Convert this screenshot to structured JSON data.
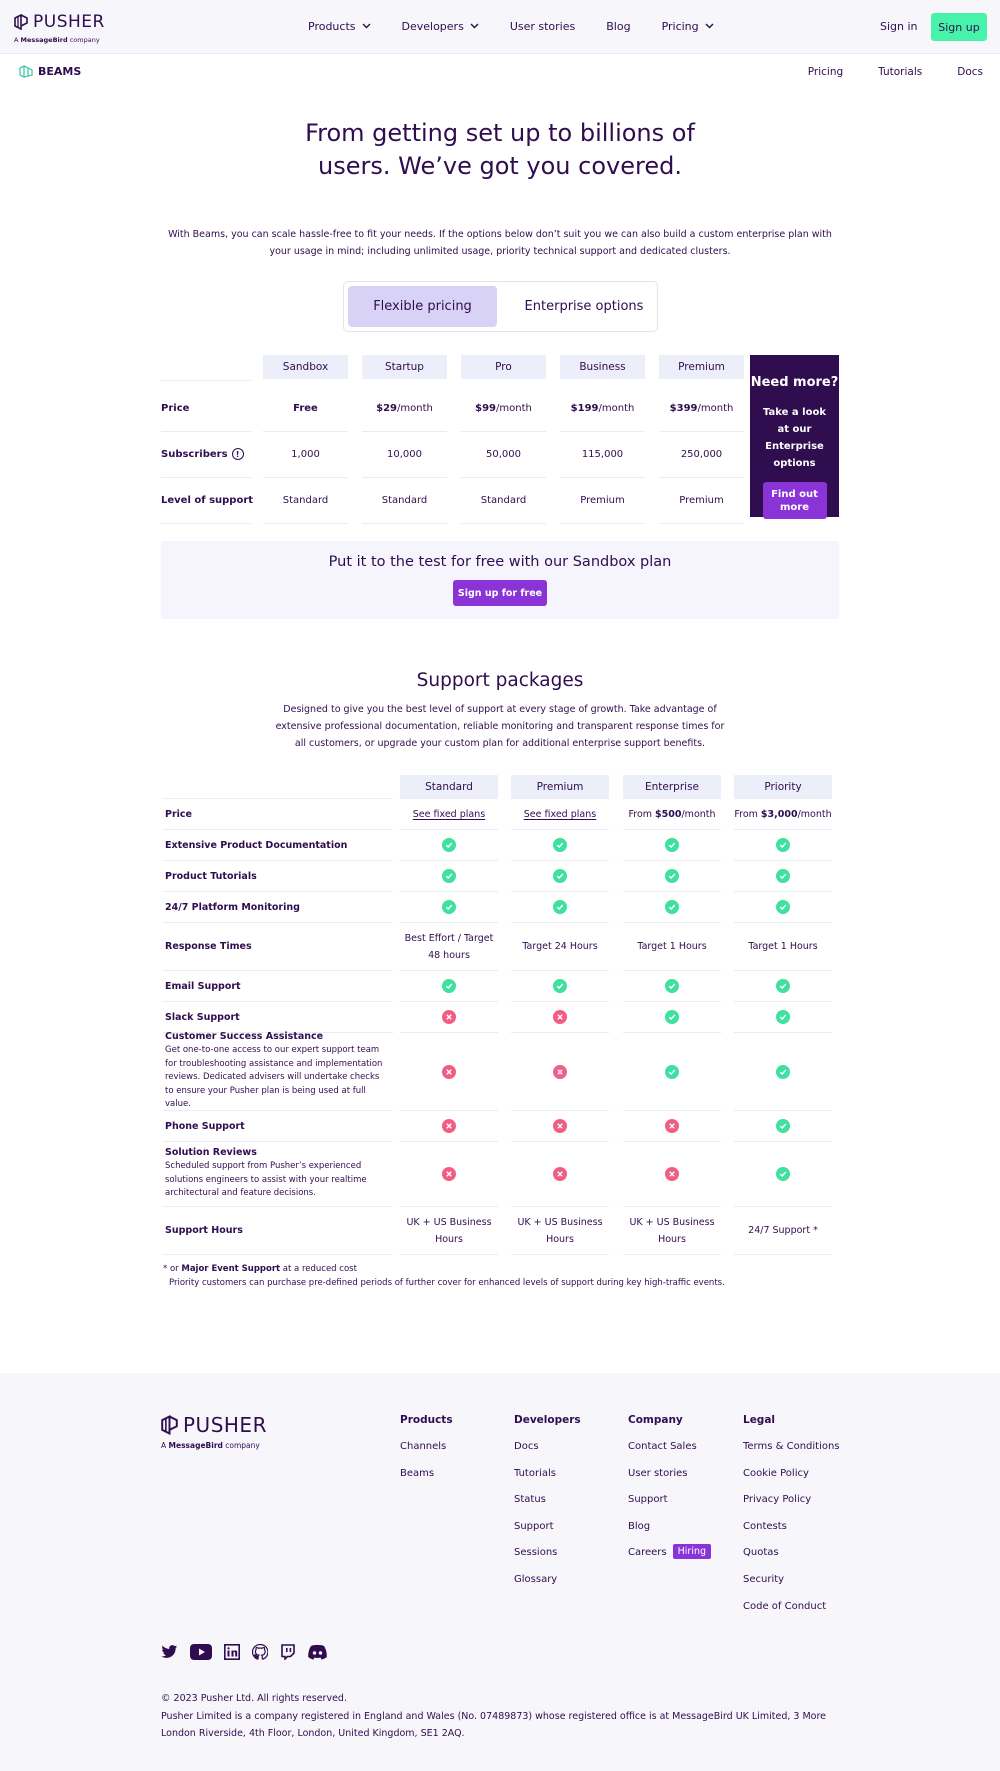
{
  "brand": {
    "name": "PUSHER",
    "tagline_prefix": "A",
    "tagline_brand": "MessageBird",
    "tagline_suffix": "company"
  },
  "nav": {
    "items": [
      {
        "label": "Products",
        "has_dropdown": true
      },
      {
        "label": "Developers",
        "has_dropdown": true
      },
      {
        "label": "User stories",
        "has_dropdown": false
      },
      {
        "label": "Blog",
        "has_dropdown": false
      },
      {
        "label": "Pricing",
        "has_dropdown": true
      }
    ],
    "sign_in": "Sign in",
    "sign_up": "Sign up"
  },
  "subnav": {
    "product": "BEAMS",
    "links": [
      "Pricing",
      "Tutorials",
      "Docs"
    ]
  },
  "hero": {
    "title": "From getting set up to billions of users. We’ve got you covered.",
    "text": "With Beams, you can scale hassle-free to fit your needs. If the options below don’t suit you we can also build a custom enterprise plan with your usage in mind; including unlimited usage, priority technical support and dedicated clusters.",
    "toggle": {
      "active": "Flexible pricing",
      "inactive": "Enterprise options"
    }
  },
  "pricing": {
    "plans": [
      "Sandbox",
      "Startup",
      "Pro",
      "Business",
      "Premium"
    ],
    "rows": [
      {
        "label": "Price",
        "cells": [
          {
            "bold": "Free",
            "rest": ""
          },
          {
            "bold": "$29",
            "rest": "/month"
          },
          {
            "bold": "$99",
            "rest": "/month"
          },
          {
            "bold": "$199",
            "rest": "/month"
          },
          {
            "bold": "$399",
            "rest": "/month"
          }
        ]
      },
      {
        "label": "Subscribers",
        "info_icon": "info-icon",
        "cells": [
          {
            "bold": "",
            "rest": "1,000"
          },
          {
            "bold": "",
            "rest": "10,000"
          },
          {
            "bold": "",
            "rest": "50,000"
          },
          {
            "bold": "",
            "rest": "115,000"
          },
          {
            "bold": "",
            "rest": "250,000"
          }
        ]
      },
      {
        "label": "Level of support",
        "cells": [
          {
            "bold": "",
            "rest": "Standard"
          },
          {
            "bold": "",
            "rest": "Standard"
          },
          {
            "bold": "",
            "rest": "Standard"
          },
          {
            "bold": "",
            "rest": "Premium"
          },
          {
            "bold": "",
            "rest": "Premium"
          }
        ]
      }
    ],
    "need_more": {
      "title": "Need more?",
      "text": "Take a look at our Enterprise options",
      "button": "Find out more"
    }
  },
  "sandbox_band": {
    "title": "Put it to the test for free with our Sandbox plan",
    "button": "Sign up for free"
  },
  "support": {
    "title": "Support packages",
    "text": "Designed to give you the best level of support at every stage of growth. Take advantage of extensive professional documentation, reliable monitoring and transparent response times for all customers, or upgrade your custom plan for additional enterprise support benefits.",
    "columns": [
      "Standard",
      "Premium",
      "Enterprise",
      "Priority"
    ],
    "price_row": {
      "label": "Price",
      "cells": [
        {
          "type": "link",
          "text": "See fixed plans"
        },
        {
          "type": "link",
          "text": "See fixed plans"
        },
        {
          "type": "price",
          "prefix": "From ",
          "bold": "$500",
          "suffix": "/month"
        },
        {
          "type": "price",
          "prefix": "From ",
          "bold": "$3,000",
          "suffix": "/month"
        }
      ]
    },
    "rows": [
      {
        "label": "Extensive Product Documentation",
        "desc": "",
        "values": [
          "yes",
          "yes",
          "yes",
          "yes"
        ]
      },
      {
        "label": "Product Tutorials",
        "desc": "",
        "values": [
          "yes",
          "yes",
          "yes",
          "yes"
        ]
      },
      {
        "label": "24/7 Platform Monitoring",
        "desc": "",
        "values": [
          "yes",
          "yes",
          "yes",
          "yes"
        ]
      },
      {
        "label": "Response Times",
        "desc": "",
        "values": [
          "Best Effort / Target 48 hours",
          "Target 24 Hours",
          "Target 1 Hours",
          "Target 1 Hours"
        ]
      },
      {
        "label": "Email Support",
        "desc": "",
        "values": [
          "yes",
          "yes",
          "yes",
          "yes"
        ]
      },
      {
        "label": "Slack Support",
        "desc": "",
        "values": [
          "no",
          "no",
          "yes",
          "yes"
        ]
      },
      {
        "label": "Customer Success Assistance",
        "desc": "Get one-to-one access to our expert support team for troubleshooting assistance and implementation reviews. Dedicated advisers will undertake checks to ensure your Pusher plan is being used at full value.",
        "values": [
          "no",
          "no",
          "yes",
          "yes"
        ]
      },
      {
        "label": "Phone Support",
        "desc": "",
        "values": [
          "no",
          "no",
          "no",
          "yes"
        ]
      },
      {
        "label": "Solution Reviews",
        "desc": "Scheduled support from Pusher’s experienced solutions engineers to assist with your realtime architectural and feature decisions.",
        "values": [
          "no",
          "no",
          "no",
          "yes"
        ]
      },
      {
        "label": "Support Hours",
        "desc": "",
        "values": [
          "UK + US Business Hours",
          "UK + US Business Hours",
          "UK + US Business Hours",
          "24/7 Support *"
        ]
      }
    ],
    "footnote": {
      "prefix": "* or ",
      "bold": "Major Event Support",
      "suffix": " at a reduced cost",
      "line2": "Priority customers can purchase pre-defined periods of further cover for enhanced levels of support during key high-traffic events."
    }
  },
  "footer": {
    "columns": [
      {
        "heading": "Products",
        "links": [
          "Channels",
          "Beams"
        ]
      },
      {
        "heading": "Developers",
        "links": [
          "Docs",
          "Tutorials",
          "Status",
          "Support",
          "Sessions",
          "Glossary"
        ]
      },
      {
        "heading": "Company",
        "links": [
          "Contact Sales",
          "User stories",
          "Support",
          "Blog",
          "Careers"
        ],
        "badge": "Hiring"
      },
      {
        "heading": "Legal",
        "links": [
          "Terms & Conditions",
          "Cookie Policy",
          "Privacy Policy",
          "Contests",
          "Quotas",
          "Security",
          "Code of Conduct"
        ]
      }
    ],
    "socials": [
      "twitter-icon",
      "youtube-icon",
      "linkedin-icon",
      "github-icon",
      "twitch-icon",
      "discord-icon"
    ],
    "copyright": "© 2023 Pusher Ltd. All rights reserved.",
    "legal": "Pusher Limited is a company registered in England and Wales (No. 07489873) whose registered office is at MessageBird UK Limited, 3 More London Riverside, 4th Floor, London, United Kingdom, SE1 2AQ."
  },
  "colors": {
    "primary": "#300d4f",
    "accent_green": "#47f3a9",
    "purple": "#8a33d6",
    "check": "#3fe0a0",
    "cross": "#f25d84",
    "header_cell": "#eceef9"
  }
}
